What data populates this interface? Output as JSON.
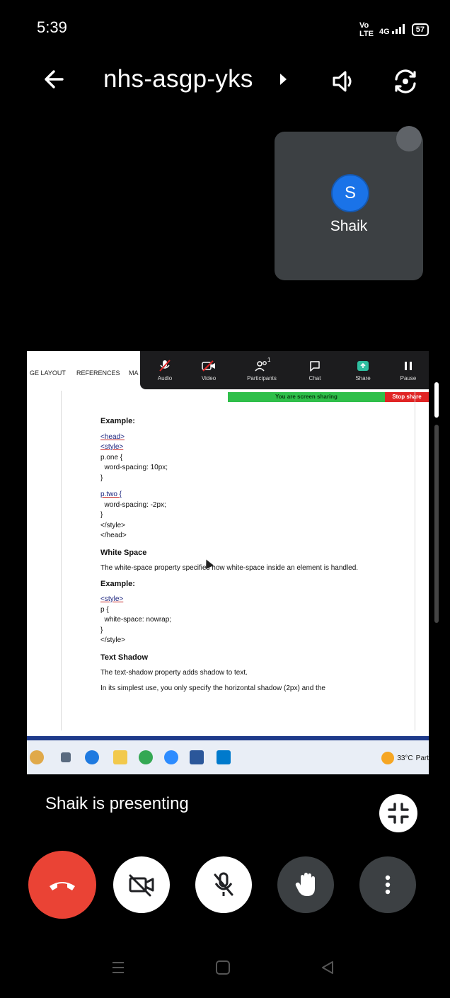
{
  "status_bar": {
    "time": "5:39",
    "network": "4G",
    "battery": "57"
  },
  "header": {
    "meeting_code": "nhs-asgp-yks"
  },
  "self_tile": {
    "avatar_initial": "S",
    "name": "Shaik"
  },
  "shared_screen": {
    "ribbon_tabs": [
      "GE LAYOUT",
      "REFERENCES",
      "MA"
    ],
    "zoom_toolbar": {
      "audio": "Audio",
      "video": "Video",
      "participants": "Participants",
      "participants_count": "1",
      "chat": "Chat",
      "share": "Share",
      "pause": "Pause"
    },
    "sharing_banner": "You are screen sharing",
    "stop_share": "Stop share",
    "document": {
      "example1_heading": "Example:",
      "code1": [
        "<head>",
        "<style>",
        "p.one {",
        "  word-spacing: 10px;",
        "}",
        "",
        "p.two {",
        "  word-spacing: -2px;",
        "}",
        "</style>",
        "</head>"
      ],
      "white_space_heading": "White Space",
      "white_space_text": "The white-space property specifies how white-space inside an element is handled.",
      "example2_heading": "Example:",
      "code2": [
        "<style>",
        "p {",
        "  white-space: nowrap;",
        "}",
        "</style>"
      ],
      "text_shadow_heading": "Text Shadow",
      "text_shadow_text": "The text-shadow property adds shadow to text.",
      "text_shadow_text2": "In its simplest use, you only specify the horizontal shadow (2px) and the"
    },
    "taskbar": {
      "weather": "33°C",
      "weather_suffix": "Part"
    }
  },
  "presenting_text": "Shaik is presenting",
  "colors": {
    "end_call": "#ea4335",
    "avatar": "#1a73e8",
    "tile_bg": "#3c4043",
    "sharing_banner": "#2fbf4a",
    "stop_share": "#e02424"
  }
}
